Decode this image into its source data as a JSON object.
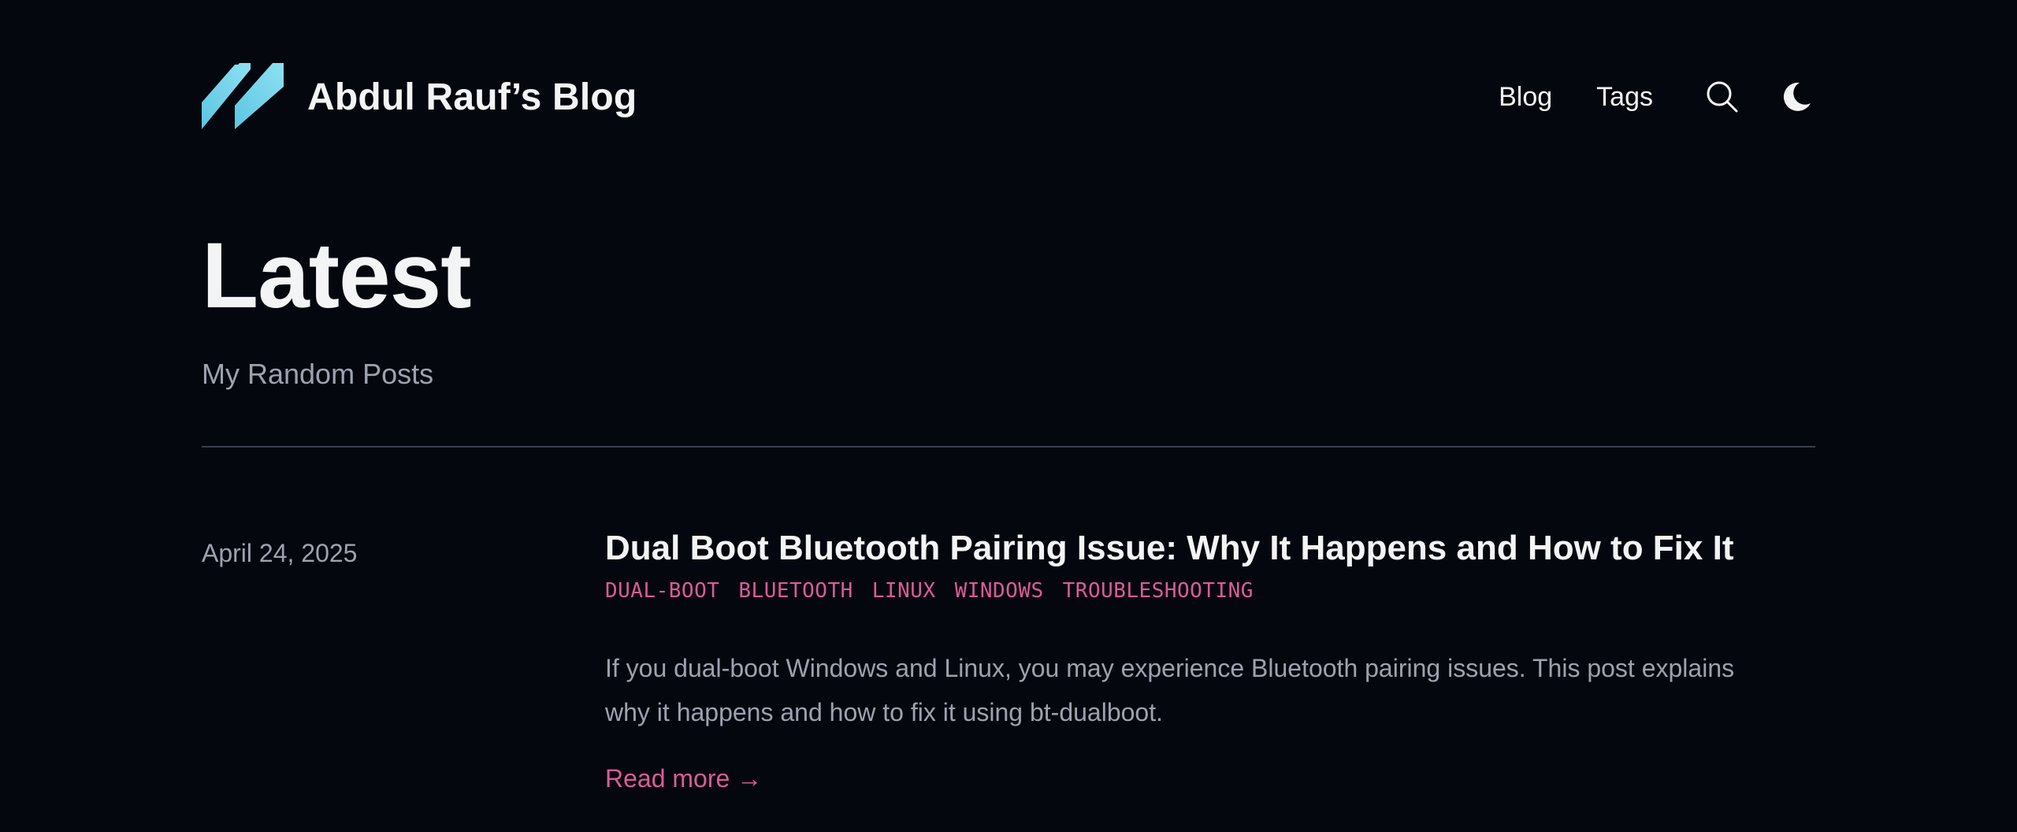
{
  "header": {
    "site_title": "Abdul Rauf’s Blog",
    "logo_icon": "logo-slashes-icon",
    "logo_color": "#6fd0e8",
    "nav": {
      "blog_label": "Blog",
      "tags_label": "Tags"
    },
    "search_icon": "search-icon",
    "theme_icon": "moon-icon"
  },
  "main": {
    "title": "Latest",
    "subtitle": "My Random Posts"
  },
  "posts": [
    {
      "date": "April 24, 2025",
      "title": "Dual Boot Bluetooth Pairing Issue: Why It Happens and How to Fix It",
      "tags": [
        "DUAL-BOOT",
        "BLUETOOTH",
        "LINUX",
        "WINDOWS",
        "TROUBLESHOOTING"
      ],
      "summary": "If you dual-boot Windows and Linux, you may experience Bluetooth pairing issues. This post explains why it happens and how to fix it using bt-dualboot.",
      "read_more": "Read more →"
    }
  ],
  "colors": {
    "background": "#05070f",
    "text": "#f3f4f6",
    "muted": "#9ca3af",
    "accent": "#db5c97",
    "divider": "#3a3f4b"
  }
}
